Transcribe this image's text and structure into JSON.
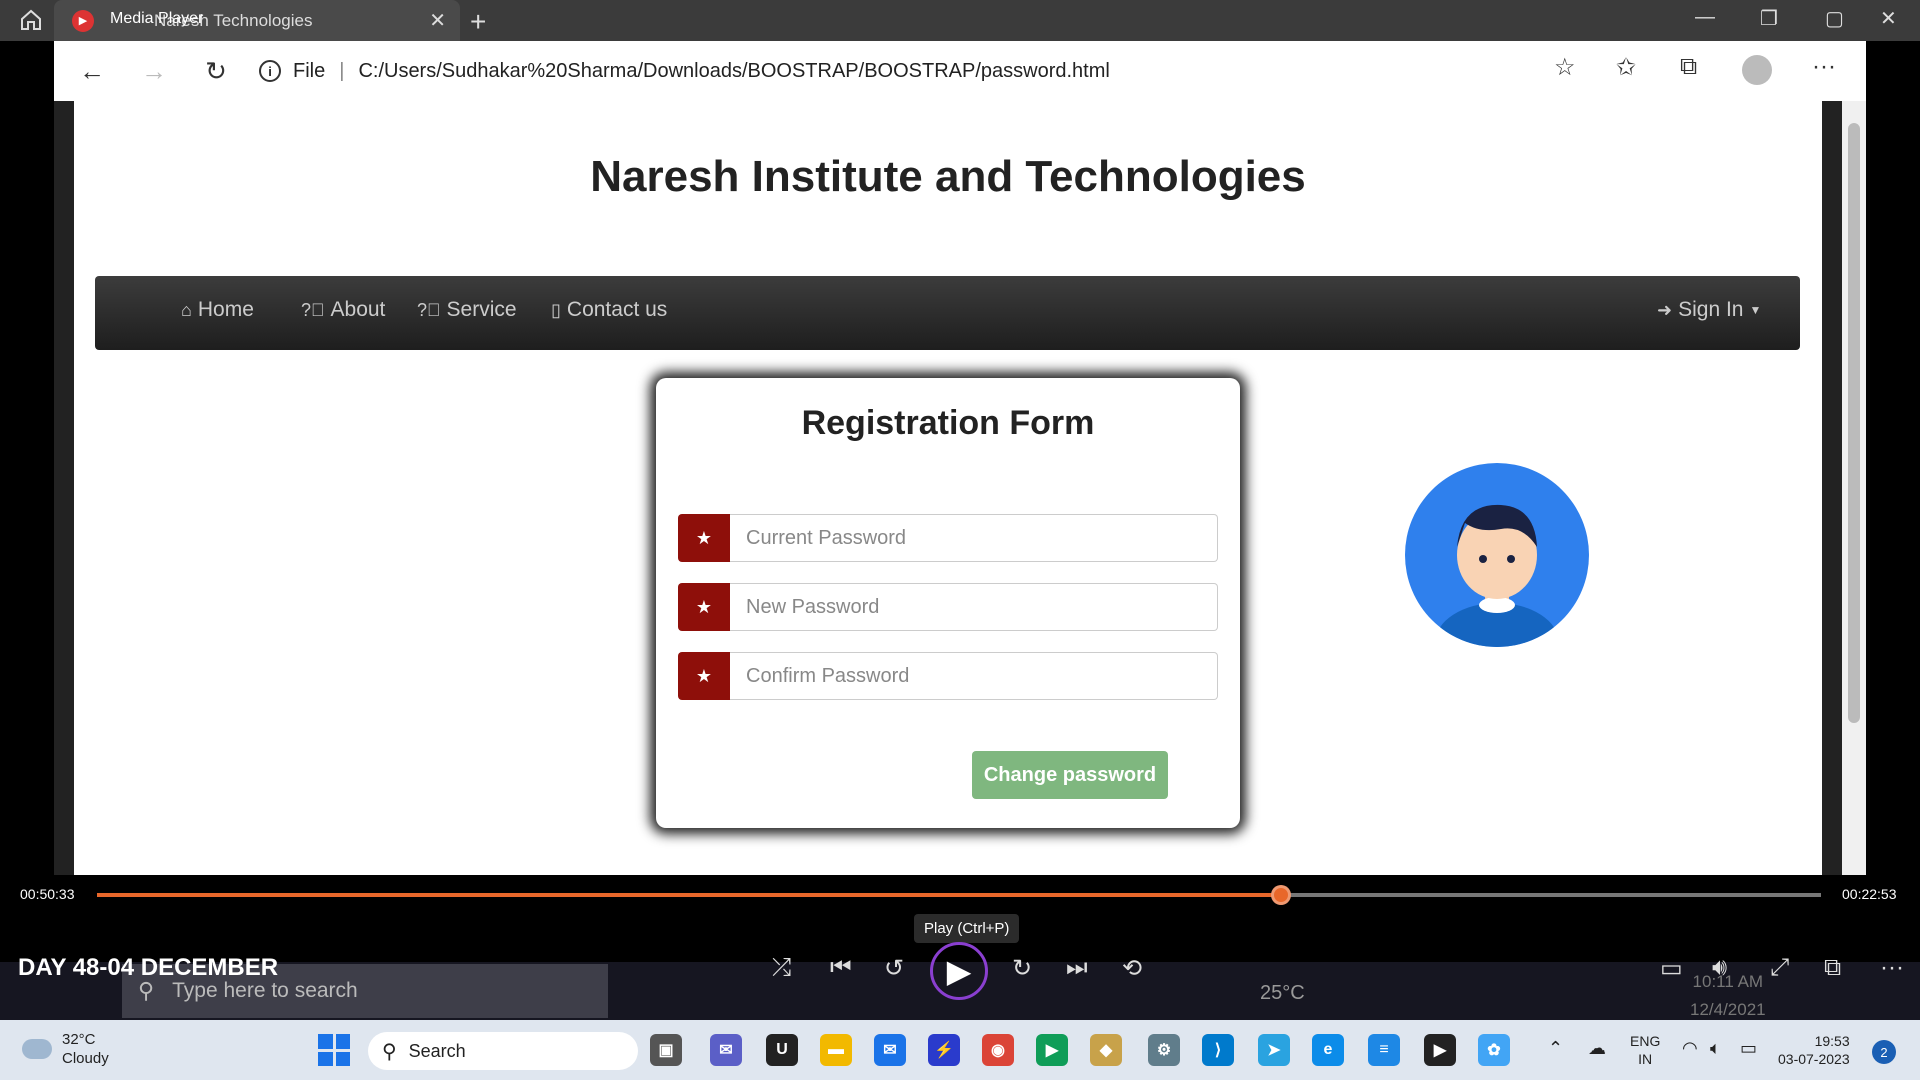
{
  "browser": {
    "tab_title": "Naresh Technologies",
    "tab_overlay_title": "Media Player",
    "url_scheme_label": "File",
    "url": "C:/Users/Sudhakar%20Sharma/Downloads/BOOSTRAP/BOOSTRAP/password.html"
  },
  "site": {
    "title": "Naresh Institute and Technologies",
    "nav": [
      {
        "label": "Home",
        "icon": "home-icon"
      },
      {
        "label": "About",
        "icon": "question-icon"
      },
      {
        "label": "Service",
        "icon": "question-icon"
      },
      {
        "label": "Contact us",
        "icon": "phone-icon"
      }
    ],
    "signin_label": "Sign In"
  },
  "form": {
    "title": "Registration Form",
    "fields": [
      {
        "placeholder": "Current Password",
        "icon": "star-icon"
      },
      {
        "placeholder": "New Password",
        "icon": "star-icon"
      },
      {
        "placeholder": "Confirm Password",
        "icon": "star-icon"
      }
    ],
    "submit_label": "Change password",
    "accent_color": "#8e0f0a",
    "button_color": "#7fb77f"
  },
  "player": {
    "time_elapsed": "00:50:33",
    "time_remaining": "00:22:53",
    "progress_fraction": 0.687,
    "tooltip": "Play (Ctrl+P)",
    "video_title": "DAY 48-04 DECEMBER"
  },
  "recorded_taskbar": {
    "search_placeholder": "Type here to search",
    "temperature": "25°C",
    "clock_time": "10:11 AM",
    "clock_date": "12/4/2021"
  },
  "taskbar": {
    "weather_temp": "32°C",
    "weather_desc": "Cloudy",
    "search_label": "Search",
    "lang_line1": "ENG",
    "lang_line2": "IN",
    "clock_time": "19:53",
    "clock_date": "03-07-2023",
    "notification_count": "2"
  }
}
